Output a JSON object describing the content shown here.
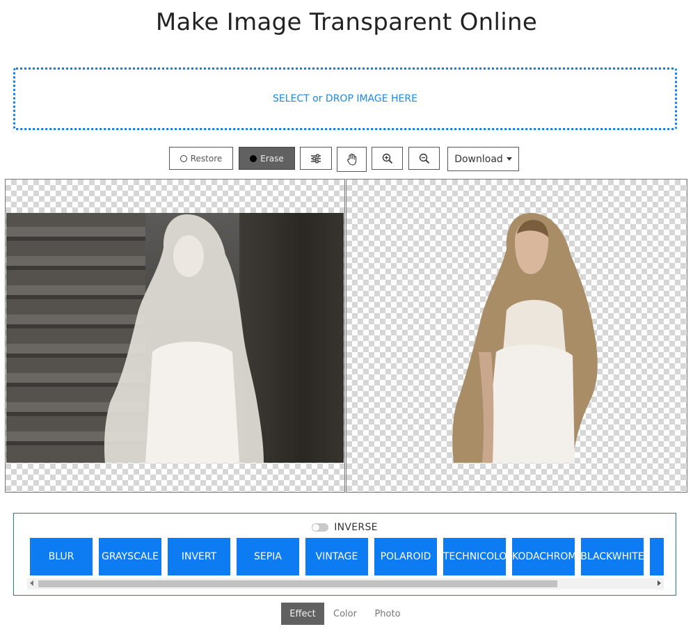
{
  "page": {
    "title": "Make Image Transparent Online"
  },
  "dropzone": {
    "label": "SELECT or DROP IMAGE HERE"
  },
  "toolbar": {
    "restore_label": "Restore",
    "erase_label": "Erase",
    "settings_icon": "sliders-icon",
    "pan_icon": "hand-icon",
    "zoom_in_icon": "zoom-in-icon",
    "zoom_out_icon": "zoom-out-icon",
    "download_label": "Download"
  },
  "inverse": {
    "label": "INVERSE",
    "enabled": false
  },
  "effects": [
    "BLUR",
    "GRAYSCALE",
    "INVERT",
    "SEPIA",
    "VINTAGE",
    "POLAROID",
    "TECHNICOLOR",
    "KODACHROME",
    "BLACKWHITE",
    ""
  ],
  "tabs": [
    {
      "label": "Effect",
      "active": true
    },
    {
      "label": "Color",
      "active": false
    },
    {
      "label": "Photo",
      "active": false
    }
  ],
  "colors": {
    "accent": "#0d7bf2",
    "active_dark": "#616161"
  }
}
